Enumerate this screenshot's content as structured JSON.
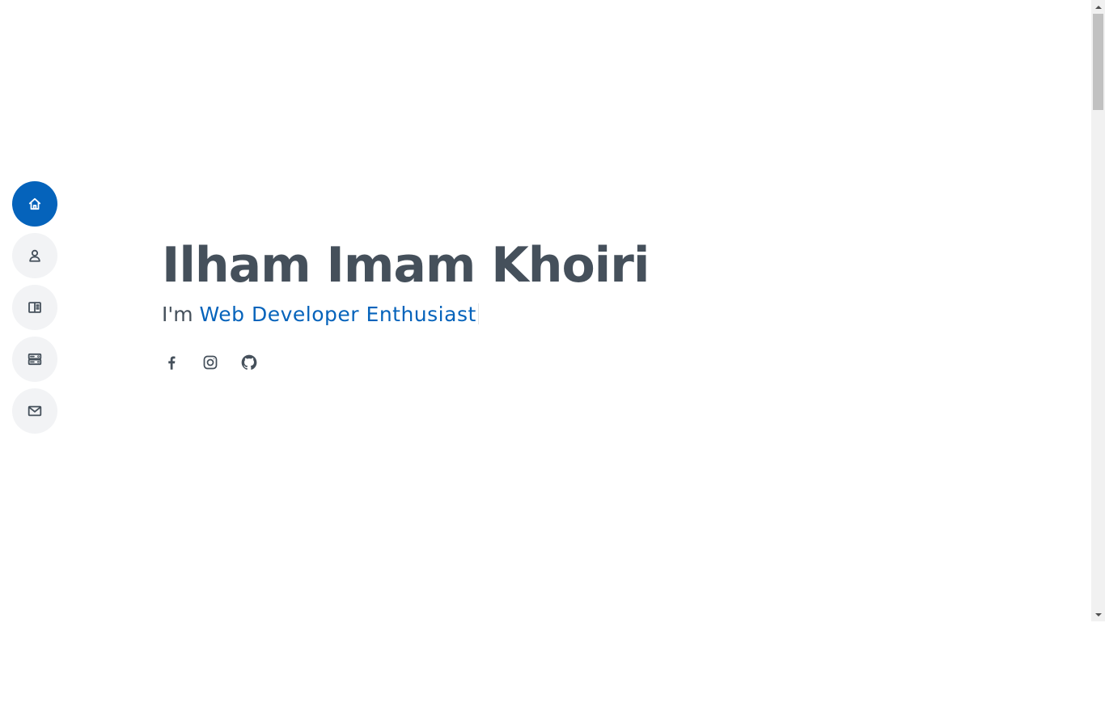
{
  "nav": {
    "items": [
      {
        "id": "home",
        "icon": "home-icon",
        "active": true
      },
      {
        "id": "about",
        "icon": "person-icon",
        "active": false
      },
      {
        "id": "resume",
        "icon": "book-icon",
        "active": false
      },
      {
        "id": "services",
        "icon": "server-icon",
        "active": false
      },
      {
        "id": "contact",
        "icon": "envelope-icon",
        "active": false
      }
    ]
  },
  "hero": {
    "name": "Ilham Imam Khoiri",
    "intro_prefix": "I'm ",
    "typed_text": "Web Developer Enthusiast"
  },
  "socials": [
    {
      "icon": "facebook-icon"
    },
    {
      "icon": "instagram-icon"
    },
    {
      "icon": "github-icon"
    }
  ],
  "colors": {
    "accent": "#0563bb",
    "text": "#45505b",
    "nav_bg": "#f2f3f5",
    "background": "#ffffff"
  }
}
